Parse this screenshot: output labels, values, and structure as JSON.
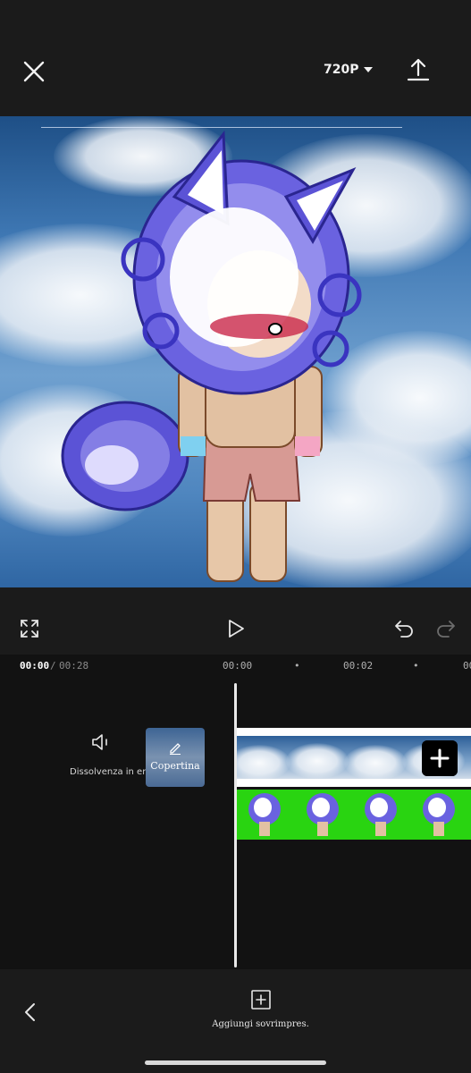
{
  "header": {
    "close_icon": "close-icon",
    "resolution": "720P",
    "export_icon": "upload-icon"
  },
  "preview": {
    "background": "sky-with-clouds",
    "subject": "gacha-character-blue-wolf"
  },
  "controls": {
    "fullscreen_icon": "fullscreen-icon",
    "play_icon": "play-icon",
    "undo_icon": "undo-icon",
    "redo_icon": "redo-icon"
  },
  "time": {
    "current": "00:00",
    "separator": "/",
    "total": "00:28",
    "ruler": [
      "00:00",
      "00:02",
      "00"
    ]
  },
  "timeline": {
    "mute_icon": "speaker-off-icon",
    "fade_label": "Dissolvenza in entrata",
    "cover_label": "Copertina",
    "add_clip_icon": "plus-icon"
  },
  "bottom": {
    "back_icon": "chevron-left-icon",
    "overlay_icon": "add-overlay-icon",
    "overlay_label": "Aggiungi sovrimpres."
  }
}
